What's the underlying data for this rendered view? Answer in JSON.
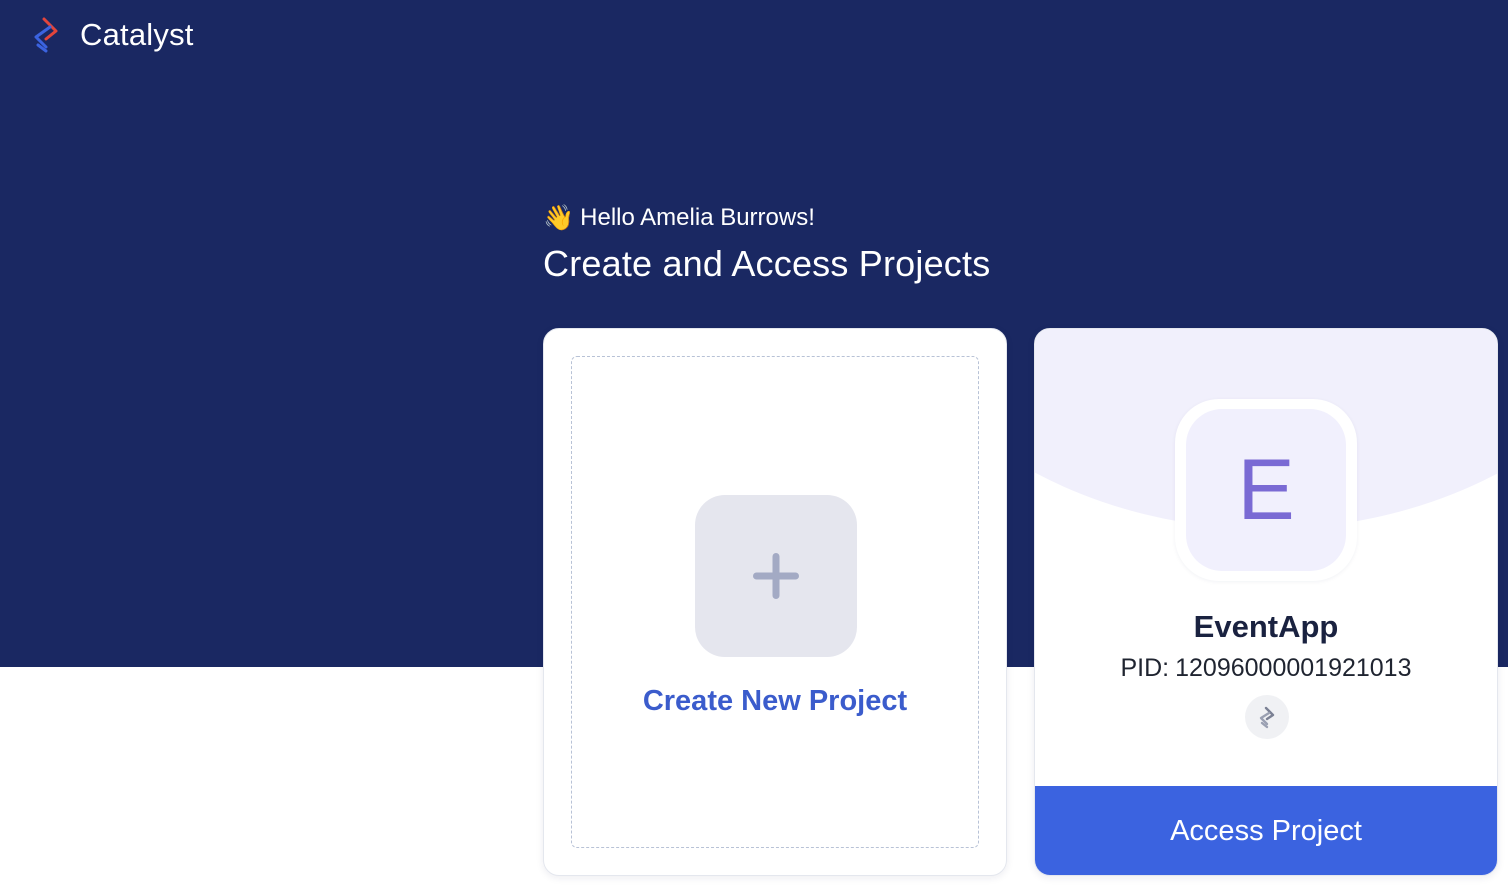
{
  "app": {
    "name": "Catalyst",
    "logo_icon": "catalyst-logo-icon",
    "colors": {
      "header_bg": "#1a2862",
      "accent": "#3b63e0",
      "link": "#3b5ccc",
      "avatar_letter": "#7a6ad4"
    }
  },
  "hero": {
    "greeting_emoji": "👋",
    "greeting": "Hello Amelia Burrows!",
    "title": "Create and Access Projects"
  },
  "create_card": {
    "icon": "plus-icon",
    "label": "Create New Project"
  },
  "project_card": {
    "avatar_letter": "E",
    "name": "EventApp",
    "pid_label": "PID:",
    "pid_value": "12096000001921013",
    "badge_icon": "catalyst-badge-icon",
    "button_label": "Access Project"
  }
}
